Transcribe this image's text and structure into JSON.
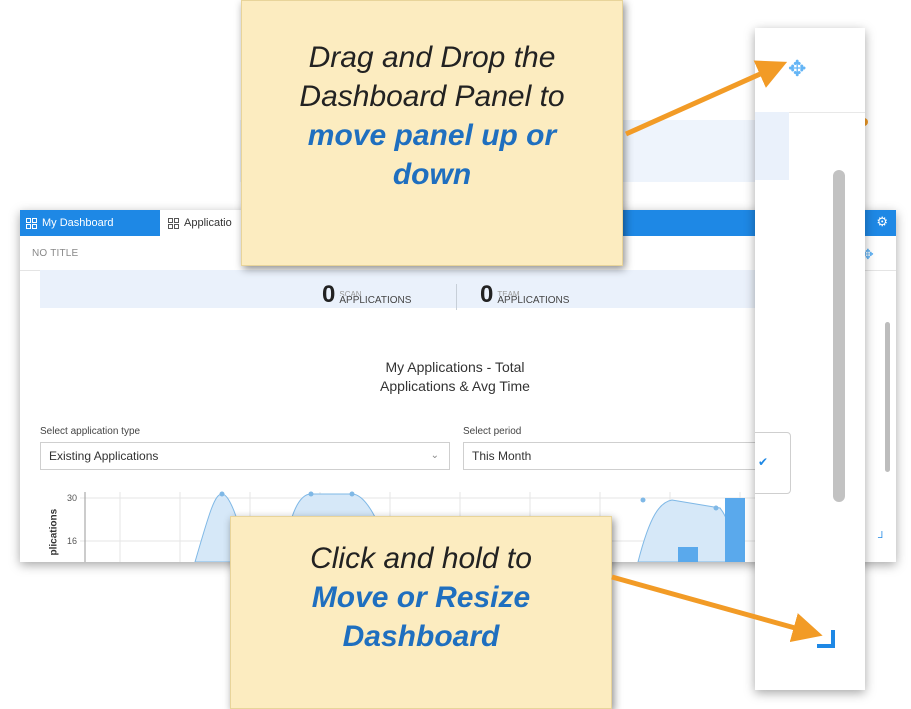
{
  "tabs": [
    {
      "label": "My Dashboard",
      "active": false
    },
    {
      "label": "Applicatio",
      "active": true
    }
  ],
  "panel": {
    "title": "NO TITLE"
  },
  "stats": [
    {
      "value": "0",
      "label_cut": "SCAN",
      "label": "APPLICATIONS"
    },
    {
      "value": "0",
      "label_cut": "TEAM",
      "label": "APPLICATIONS"
    }
  ],
  "chart_title_line1": "My Applications - Total",
  "chart_title_line2": "Applications & Avg Time",
  "filters": {
    "type_label": "Select application type",
    "type_value": "Existing Applications",
    "period_label": "Select period",
    "period_value": "This Month"
  },
  "chart_data": {
    "type": "area",
    "ylabel": "plications",
    "y_ticks": [
      "30",
      "16"
    ]
  },
  "callouts": {
    "top_line1": "Drag and Drop the",
    "top_line2": "Dashboard Panel to",
    "top_blue1": "move panel up or",
    "top_blue2": "down",
    "bottom_line1": "Click and hold to",
    "bottom_blue1": "Move or Resize",
    "bottom_blue2": "Dashboard"
  },
  "colors": {
    "accent": "#1e88e5",
    "callout_bg": "#fcecc0",
    "arrow": "#f29b26",
    "callout_blue": "#1f6fbf"
  },
  "icons": [
    "dashboard-grid-icon",
    "gear-icon",
    "move-arrows-icon",
    "resize-corner-icon",
    "chevron-down-icon",
    "check-icon"
  ]
}
